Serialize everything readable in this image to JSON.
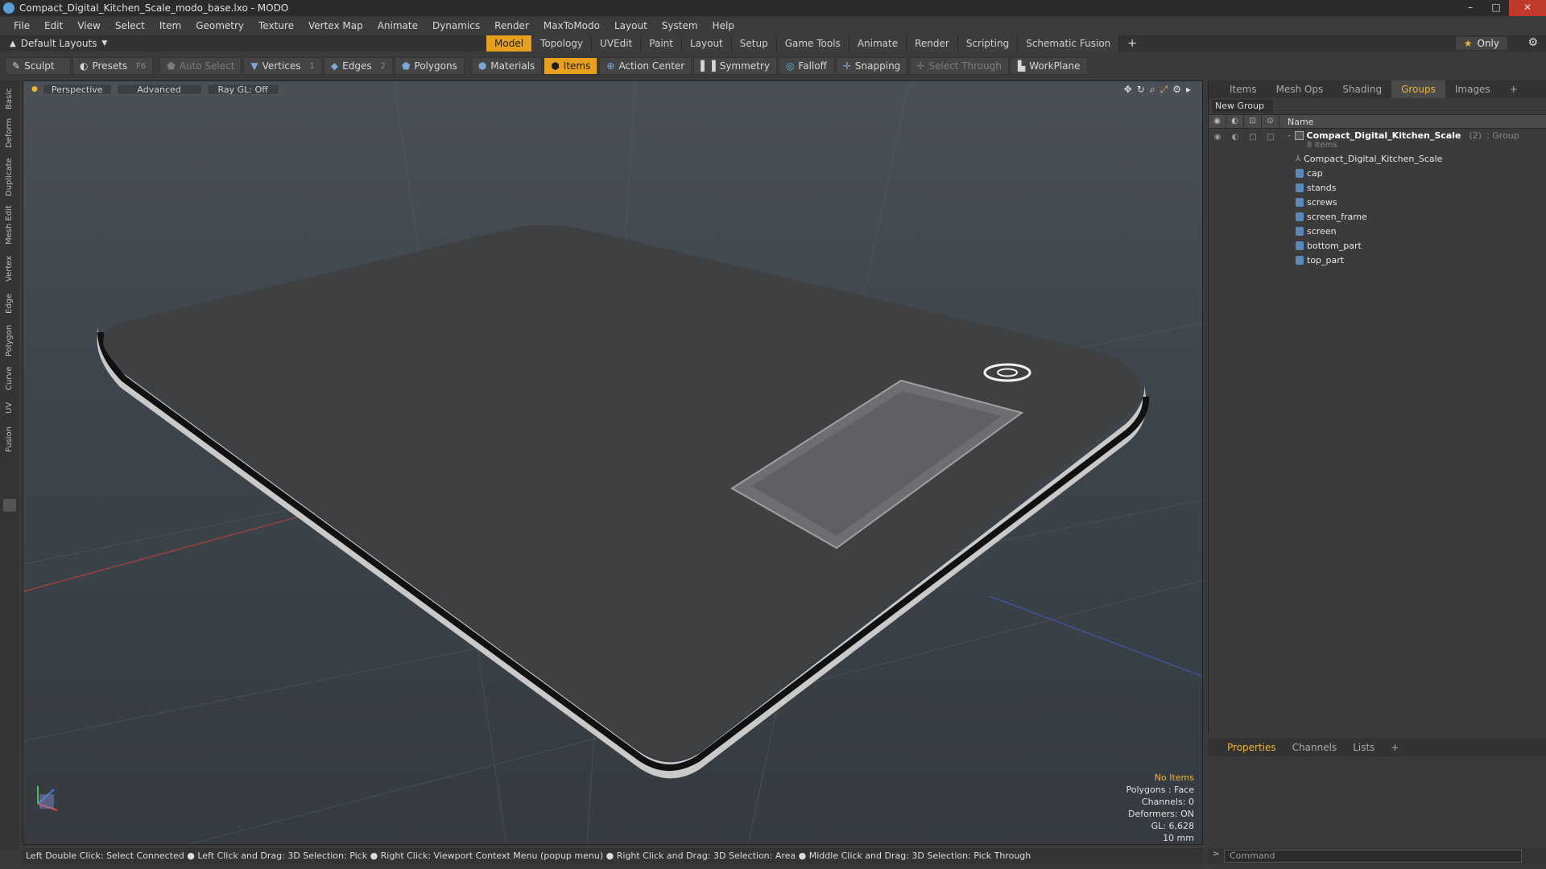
{
  "window": {
    "title": "Compact_Digital_Kitchen_Scale_modo_base.lxo - MODO"
  },
  "menu": [
    "File",
    "Edit",
    "View",
    "Select",
    "Item",
    "Geometry",
    "Texture",
    "Vertex Map",
    "Animate",
    "Dynamics",
    "Render",
    "MaxToModo",
    "Layout",
    "System",
    "Help"
  ],
  "layout": {
    "label": "Default Layouts"
  },
  "main_tabs": [
    "Model",
    "Topology",
    "UVEdit",
    "Paint",
    "Layout",
    "Setup",
    "Game Tools",
    "Animate",
    "Render",
    "Scripting",
    "Schematic Fusion"
  ],
  "only_label": "Only",
  "toolbar": {
    "sculpt": "Sculpt",
    "presets": "Presets",
    "presets_key": "F6",
    "auto_select": "Auto Select",
    "vertices": "Vertices",
    "vertices_num": "1",
    "edges": "Edges",
    "edges_num": "2",
    "polygons": "Polygons",
    "materials": "Materials",
    "items": "Items",
    "action_center": "Action Center",
    "symmetry": "Symmetry",
    "falloff": "Falloff",
    "snapping": "Snapping",
    "select_through": "Select Through",
    "workplane": "WorkPlane"
  },
  "left_tabs": [
    "Basic",
    "Deform",
    "Duplicate",
    "Mesh Edit",
    "Vertex",
    "Edge",
    "Polygon",
    "Curve",
    "UV",
    "Fusion"
  ],
  "viewport": {
    "perspective": "Perspective",
    "advanced": "Advanced",
    "raygl": "Ray GL: Off",
    "stats": {
      "items": "No Items",
      "polygons": "Polygons : Face",
      "channels": "Channels: 0",
      "deformers": "Deformers: ON",
      "gl": "GL: 6,628",
      "unit": "10 mm"
    }
  },
  "right_panel": {
    "tabs": [
      "Items",
      "Mesh Ops",
      "Shading",
      "Groups",
      "Images"
    ],
    "new_group": "New Group",
    "name_header": "Name",
    "group": {
      "name": "Compact_Digital_Kitchen_Scale",
      "count": "(2)",
      "type": ": Group",
      "items_count": "8 Items"
    },
    "items": [
      "Compact_Digital_Kitchen_Scale",
      "cap",
      "stands",
      "screws",
      "screen_frame",
      "screen",
      "bottom_part",
      "top_part"
    ]
  },
  "bottom_tabs": [
    "Properties",
    "Channels",
    "Lists"
  ],
  "status": "Left Double Click: Select Connected ● Left Click and Drag: 3D Selection: Pick ● Right Click: Viewport Context Menu (popup menu) ● Right Click and Drag: 3D Selection: Area ● Middle Click and Drag: 3D Selection: Pick Through",
  "command_placeholder": "Command"
}
